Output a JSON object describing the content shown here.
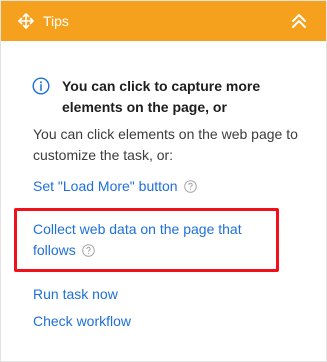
{
  "header": {
    "title": "Tips",
    "move_icon": "move-arrows-icon",
    "collapse_icon": "double-chevron-up-icon"
  },
  "info": {
    "icon": "info-circle-icon",
    "heading": "You can click to capture more elements on the page, or"
  },
  "description": "You can click elements on the web page to customize the task, or:",
  "links": {
    "load_more": "Set \"Load More\" button",
    "collect_data": "Collect web data on the page that follows",
    "run_task": "Run task now",
    "check_workflow": "Check workflow"
  },
  "colors": {
    "header_bg": "#f5a11d",
    "link": "#1e6fd9",
    "highlight_border": "#f0111a",
    "info_icon": "#1e6fd9",
    "help_icon": "#a6a6a6"
  }
}
